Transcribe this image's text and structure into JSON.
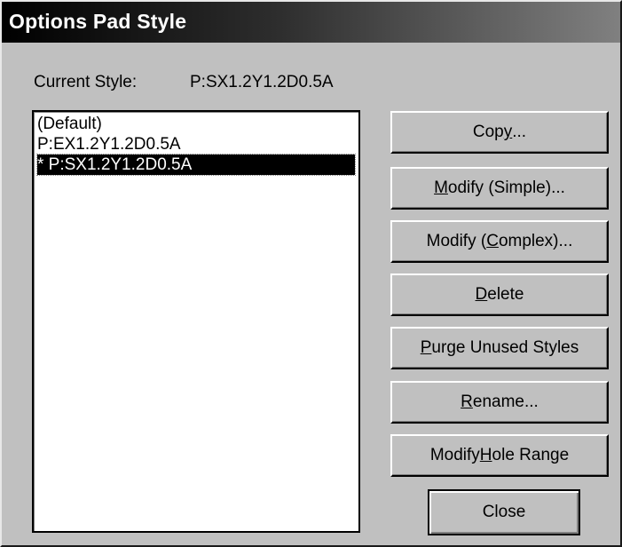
{
  "window": {
    "title": "Options Pad Style"
  },
  "current_style": {
    "label": "Current Style:",
    "value": "P:SX1.2Y1.2D0.5A"
  },
  "styles_list": {
    "items": [
      {
        "label": "(Default)",
        "selected": false
      },
      {
        "label": "P:EX1.2Y1.2D0.5A",
        "selected": false
      },
      {
        "label": "* P:SX1.2Y1.2D0.5A",
        "selected": true
      }
    ]
  },
  "buttons": {
    "copy": {
      "pre": "Cop",
      "mnemonic": "y",
      "post": "..."
    },
    "modify_simple": {
      "pre": "",
      "mnemonic": "M",
      "post": "odify (Simple)..."
    },
    "modify_complex": {
      "pre": "Modify (",
      "mnemonic": "C",
      "post": "omplex)..."
    },
    "delete": {
      "pre": "",
      "mnemonic": "D",
      "post": "elete"
    },
    "purge": {
      "pre": "",
      "mnemonic": "P",
      "post": "urge Unused Styles"
    },
    "rename": {
      "pre": "",
      "mnemonic": "R",
      "post": "ename..."
    },
    "modify_hole_range": {
      "pre": "Modify ",
      "mnemonic": "H",
      "post": "ole Range"
    },
    "close": {
      "label": "Close"
    }
  },
  "colors": {
    "dialog_bg": "#c0c0c0",
    "title_gradient_start": "#000000",
    "title_gradient_end": "#808080",
    "selection_bg": "#000000",
    "selection_fg": "#ffffff"
  }
}
